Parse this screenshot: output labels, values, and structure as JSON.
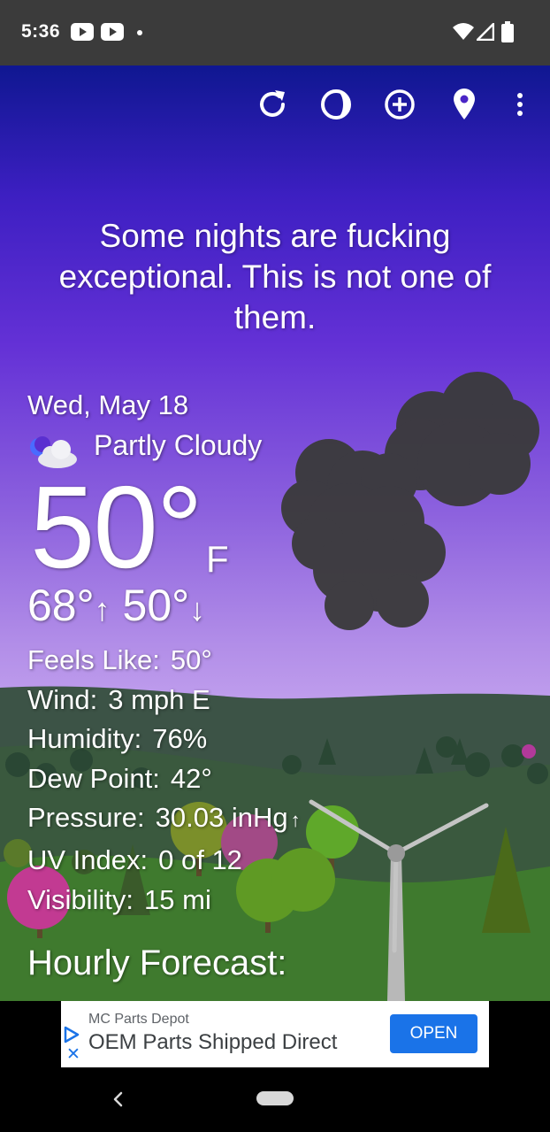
{
  "status_bar": {
    "time": "5:36",
    "icons": [
      "youtube-notification-icon",
      "youtube-notification-icon",
      "notification-dot-icon",
      "wifi-icon",
      "cell-signal-icon",
      "battery-icon"
    ]
  },
  "toolbar": {
    "icons": [
      "refresh-icon",
      "theme-icon",
      "add-location-icon",
      "location-pin-icon",
      "more-vert-icon"
    ]
  },
  "headline": "Some nights are fucking exceptional. This is not one of them.",
  "current": {
    "date": "Wed, May 18",
    "condition": "Partly Cloudy",
    "condition_icon": "partly-cloudy-night-icon",
    "temperature": "50°",
    "unit": "F",
    "high": "68°",
    "high_arrow": "↑",
    "low": "50°",
    "low_arrow": "↓"
  },
  "details": {
    "feels_like": {
      "label": "Feels Like:",
      "value": "50°"
    },
    "wind": {
      "label": "Wind:",
      "value": "3 mph E"
    },
    "humidity": {
      "label": "Humidity:",
      "value": "76%"
    },
    "dew_point": {
      "label": "Dew Point:",
      "value": "42°"
    },
    "pressure": {
      "label": "Pressure:",
      "value": "30.03 inHg",
      "trend": "↑"
    },
    "uv_index": {
      "label": "UV Index:",
      "value": "0 of 12"
    },
    "visibility": {
      "label": "Visibility:",
      "value": "15 mi"
    }
  },
  "hourly_title": "Hourly Forecast:",
  "ad": {
    "advertiser": "MC Parts Depot",
    "headline": "OEM Parts Shipped Direct",
    "cta": "OPEN",
    "close": "✕"
  },
  "colors": {
    "sky_top": "#0f1791",
    "sky_bottom": "#c8a8f0",
    "cloud": "#3a3a3a",
    "hills": "#2f4a3a",
    "ad_accent": "#1a73e8",
    "status_bar": "#3b3b3b"
  }
}
